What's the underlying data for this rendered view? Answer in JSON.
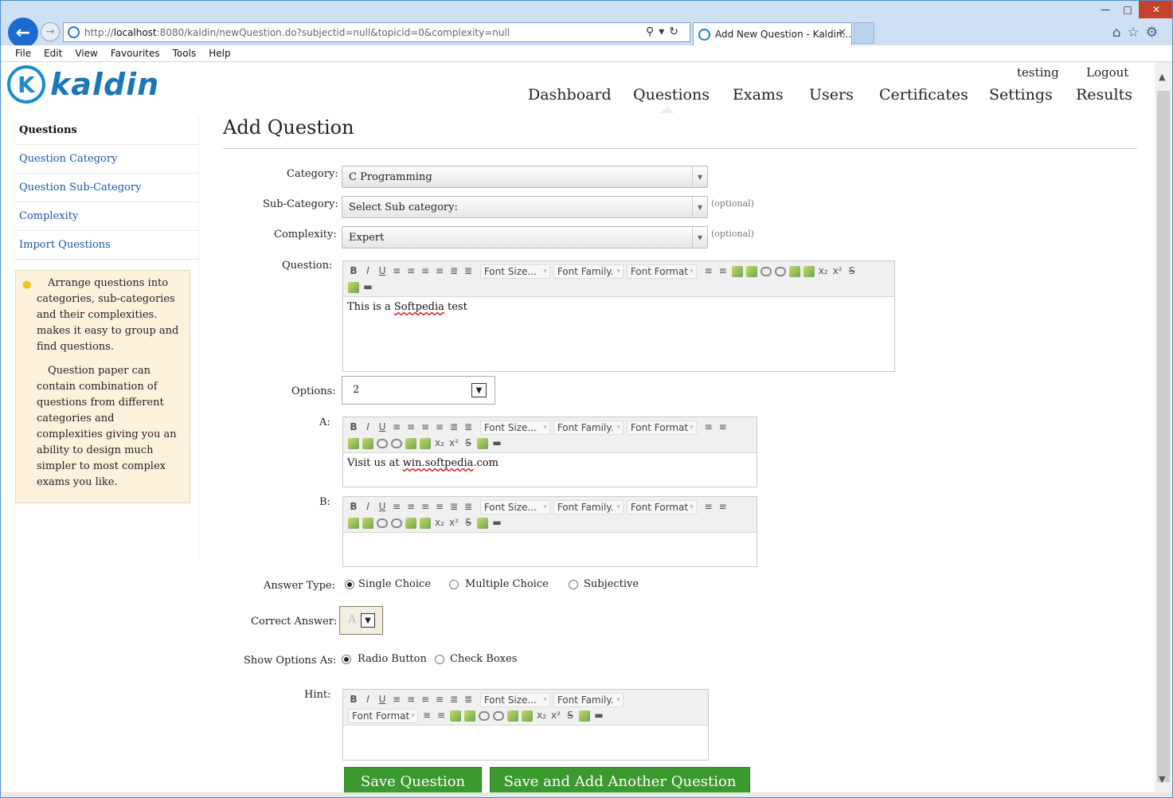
{
  "browser": {
    "url_prefix": "http://",
    "url_host": "localhost",
    "url_rest": ":8080/kaldin/newQuestion.do?subjectid=null&topicid=0&complexity=null",
    "tab_title": "Add New Question - Kaldin...",
    "menu": [
      "File",
      "Edit",
      "View",
      "Favourites",
      "Tools",
      "Help"
    ]
  },
  "header": {
    "logo_text": "kaldin",
    "user": "testing",
    "logout": "Logout",
    "nav": [
      "Dashboard",
      "Questions",
      "Exams",
      "Users",
      "Certificates",
      "Settings",
      "Results"
    ]
  },
  "sidebar": {
    "heading": "Questions",
    "items": [
      "Question Category",
      "Question Sub-Category",
      "Complexity",
      "Import Questions"
    ],
    "tip_p1": "Arrange questions into categories, sub-categories and their complexities. makes it easy to group and find questions.",
    "tip_p2": "Question paper can contain combination of questions from different categories and complexities giving you an ability to design much simpler to most complex exams you like."
  },
  "form": {
    "title": "Add Question",
    "category_label": "Category:",
    "category_value": "C Programming",
    "subcategory_label": "Sub-Category:",
    "subcategory_value": "Select Sub category:",
    "complexity_label": "Complexity:",
    "complexity_value": "Expert",
    "optional": "(optional)",
    "question_label": "Question:",
    "question_text_pre": "This is a ",
    "question_text_sq": "Softpedia",
    "question_text_post": " test",
    "options_label": "Options:",
    "options_value": "2",
    "a_label": "A:",
    "a_text_pre": "Visit us at ",
    "a_text_sq": "win.softpedia",
    "a_text_post": ".com",
    "b_label": "B:",
    "answer_type_label": "Answer Type:",
    "answer_types": [
      "Single Choice",
      "Multiple Choice",
      "Subjective"
    ],
    "correct_label": "Correct Answer:",
    "correct_value": "A",
    "show_label": "Show Options As:",
    "show_options": [
      "Radio Button",
      "Check Boxes"
    ],
    "hint_label": "Hint:",
    "toolbar": {
      "font_size": "Font Size...",
      "font_family": "Font Family.",
      "font_format": "Font Format"
    },
    "save_button": "Save Question",
    "save_add_button": "Save and Add Another Question"
  }
}
